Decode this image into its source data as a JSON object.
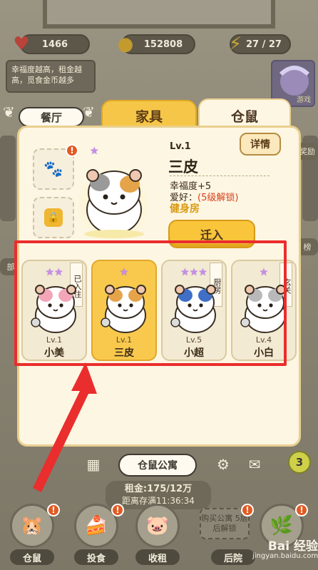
{
  "stats": {
    "hearts": "1466",
    "coins": "152808",
    "energy": "27 / 27"
  },
  "hint": "幸福度越高，租金越高，觅食金币越多",
  "event_card_label": "游戏",
  "tabs": {
    "restaurant": "餐厅",
    "furniture": "家具",
    "hamster": "仓鼠"
  },
  "selected": {
    "level": "Lv.1",
    "name": "三皮",
    "happiness": "幸福度+5",
    "hobby_label": "爱好：",
    "hobby_value": "(5级解锁)",
    "room": "健身房",
    "detail_button": "详情",
    "move_in_button": "迁入",
    "stars": 1
  },
  "slot_badge": "!",
  "cards": [
    {
      "name": "小美",
      "level": "Lv.1",
      "stars": "★★",
      "ribbon": "已入住",
      "selected": false,
      "accent": "#f2a6b8"
    },
    {
      "name": "三皮",
      "level": "Lv.1",
      "stars": "★",
      "ribbon": "",
      "selected": true,
      "accent": "#e6a44a"
    },
    {
      "name": "小超",
      "level": "Lv.5",
      "stars": "★★★",
      "ribbon": "厨房",
      "selected": false,
      "accent": "#3f6fc7"
    },
    {
      "name": "小白",
      "level": "Lv.4",
      "stars": "★",
      "ribbon": "玄关",
      "selected": false,
      "accent": "#b9b9b9"
    }
  ],
  "apartment_button": "仓鼠公寓",
  "rent": {
    "amount": "租金:175/12万",
    "time": "距离存满11:36:34"
  },
  "level_badge": "3",
  "buy_apartment": "购买公寓 5层后解锁",
  "nav": [
    {
      "label": "仓鼠",
      "icon": "hamster-icon"
    },
    {
      "label": "投食",
      "icon": "food-icon"
    },
    {
      "label": "收租",
      "icon": "piggy-bank-icon"
    },
    {
      "label": "后院",
      "icon": "backyard-icon"
    }
  ],
  "watermark": {
    "title": "Bai 经验",
    "url": "jingyan.baidu.com"
  },
  "side": {
    "left_chip": "部",
    "right_chip_1": "榜",
    "right_chip_2": "奖励"
  },
  "colors": {
    "highlight": "#ea2d2d",
    "accent_yellow": "#f9c53a",
    "star_purple": "#c58de8"
  }
}
